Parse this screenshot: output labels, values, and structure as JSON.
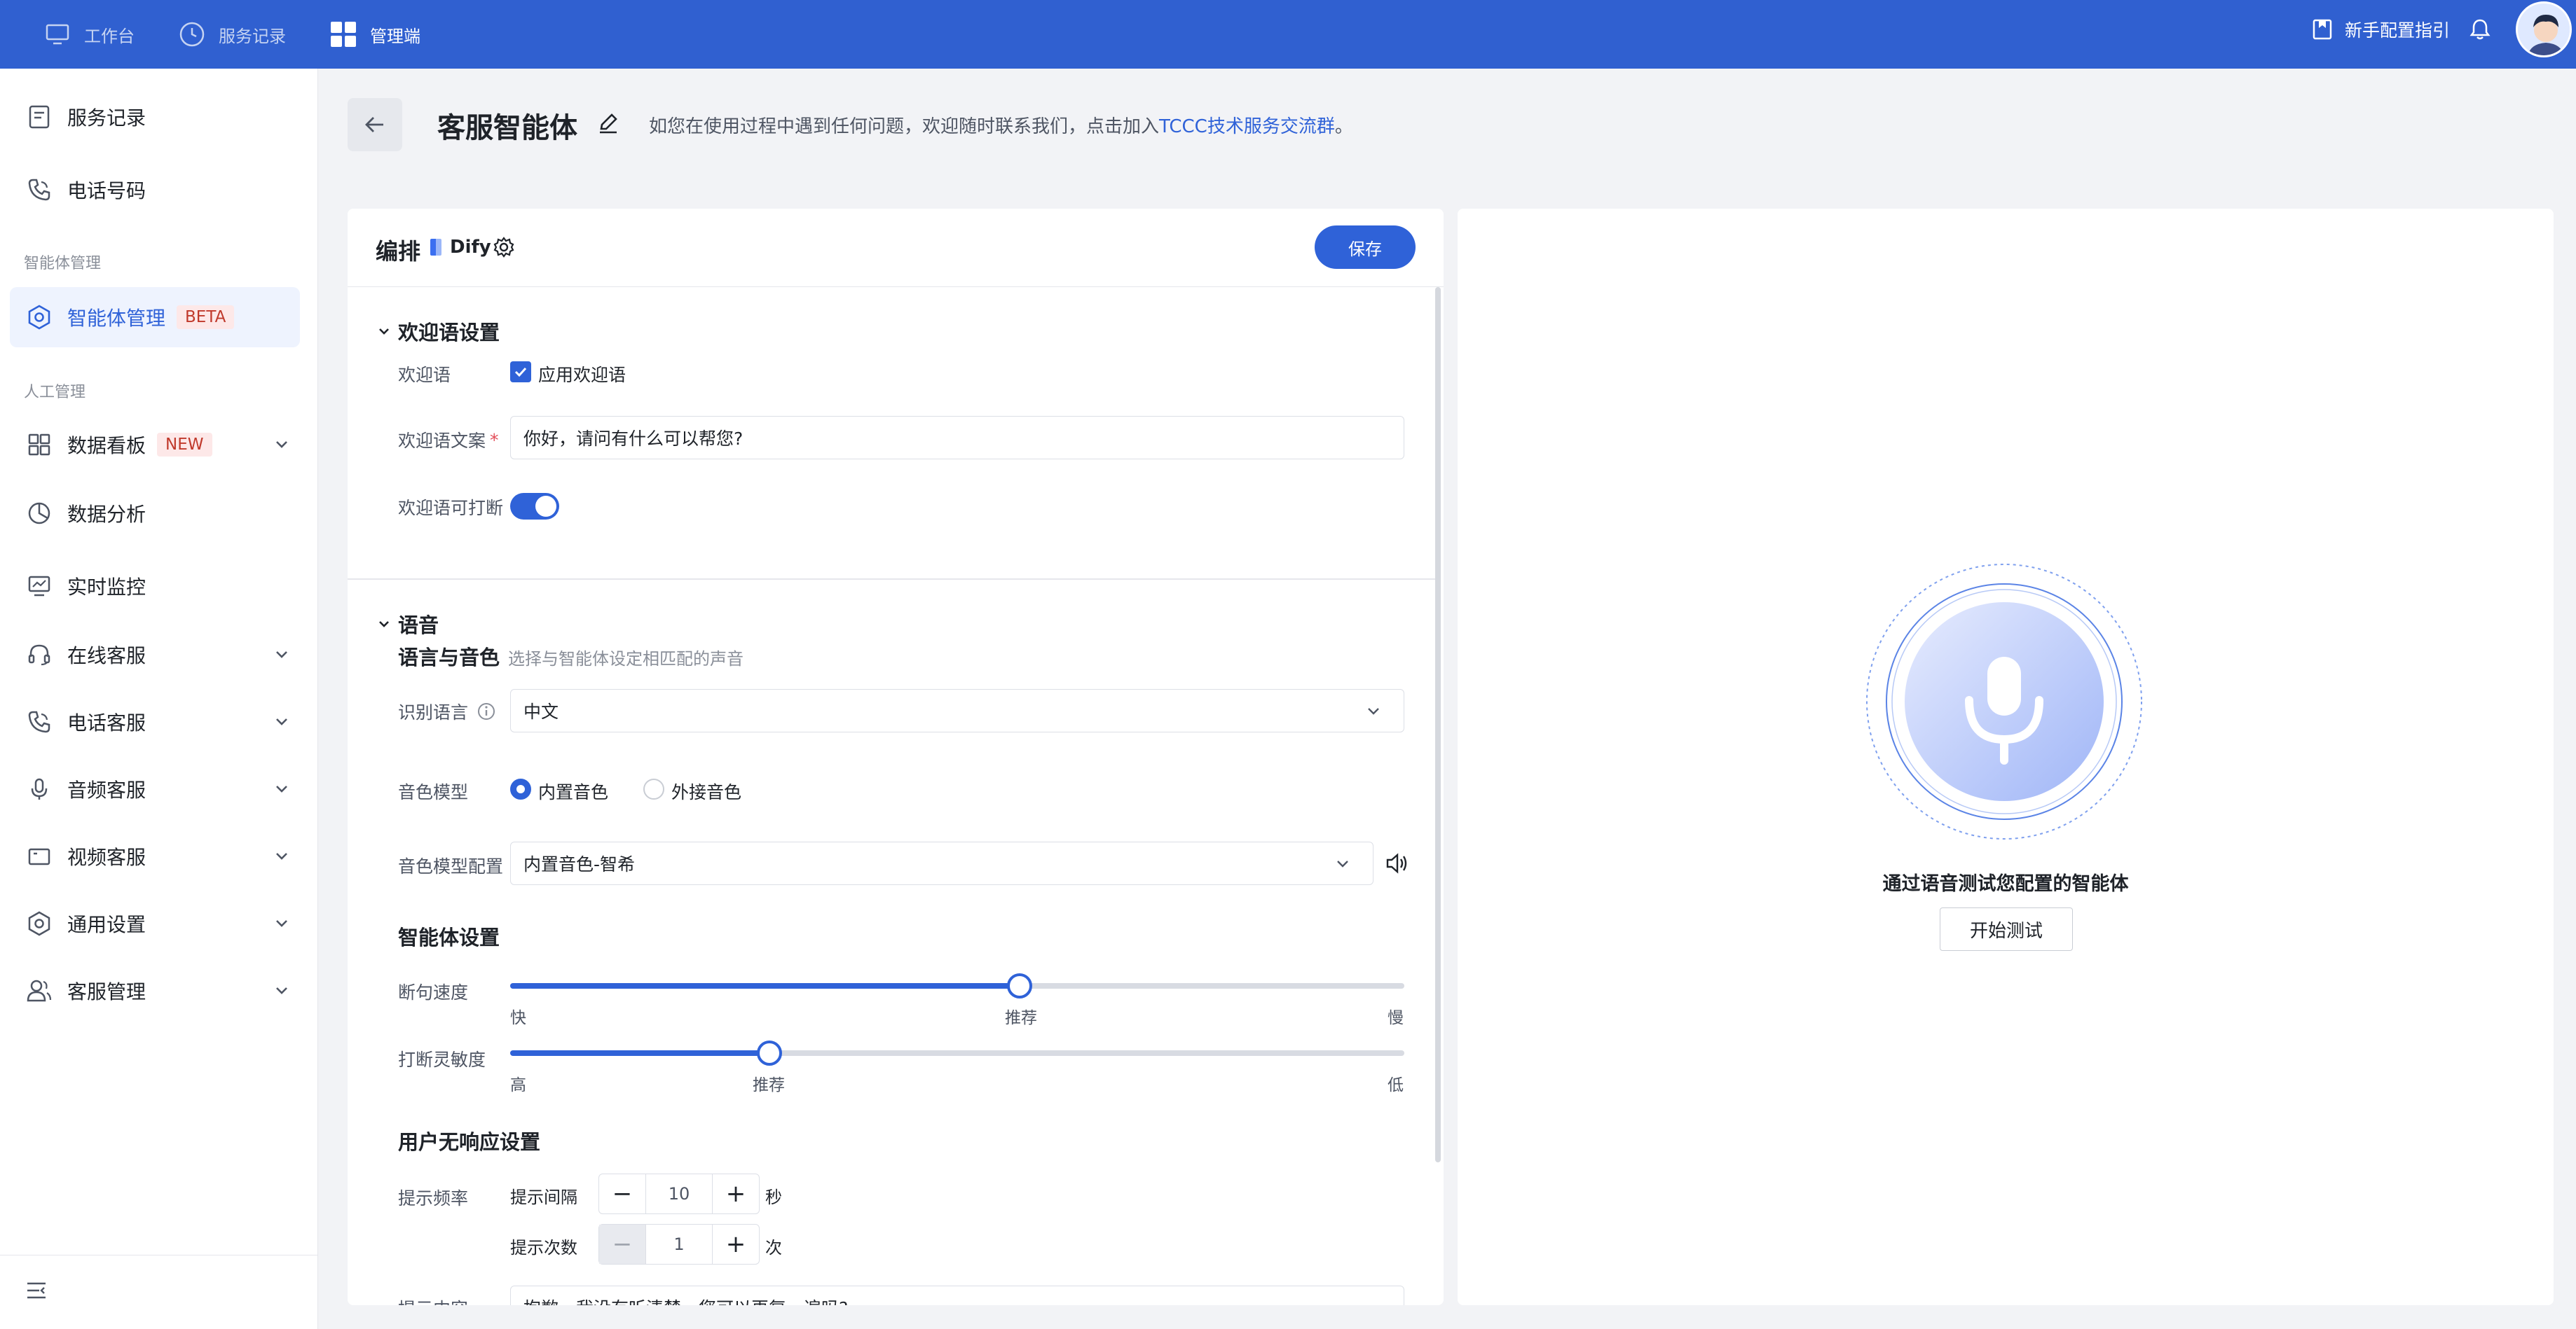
{
  "topbar": {
    "nav": [
      {
        "label": "工作台",
        "icon": "monitor-icon"
      },
      {
        "label": "服务记录",
        "icon": "clock-icon"
      },
      {
        "label": "管理端",
        "icon": "grid-icon"
      }
    ],
    "guide_label": "新手配置指引",
    "colors": {
      "bar": "#3060d0",
      "accent": "#2f62d8"
    }
  },
  "sidebar": {
    "items_top": [
      {
        "label": "服务记录",
        "icon": "document-icon"
      },
      {
        "label": "电话号码",
        "icon": "phone-icon"
      }
    ],
    "group_agent": "智能体管理",
    "agent_item": {
      "label": "智能体管理",
      "badge": "BETA",
      "icon": "hexagon-gear-icon"
    },
    "group_manual": "人工管理",
    "items_manual": [
      {
        "label": "数据看板",
        "badge": "NEW",
        "icon": "dashboard-icon"
      },
      {
        "label": "数据分析",
        "icon": "pie-icon"
      },
      {
        "label": "实时监控",
        "icon": "monitor-chart-icon"
      },
      {
        "label": "在线客服",
        "icon": "headset-icon"
      },
      {
        "label": "电话客服",
        "icon": "phone-icon"
      },
      {
        "label": "音频客服",
        "icon": "microphone-icon"
      },
      {
        "label": "视频客服",
        "icon": "video-icon"
      },
      {
        "label": "通用设置",
        "icon": "gear-icon"
      },
      {
        "label": "客服管理",
        "icon": "users-icon"
      }
    ]
  },
  "header": {
    "title": "客服智能体",
    "hint_prefix": "如您在使用过程中遇到任何问题，欢迎随时联系我们，点击加入",
    "hint_link": "TCCC技术服务交流群",
    "hint_suffix": "。"
  },
  "editor": {
    "title": "编排",
    "provider": "Dify",
    "save_label": "保存",
    "welcome": {
      "section_title": "欢迎语设置",
      "label_welcome": "欢迎语",
      "checkbox_label": "应用欢迎语",
      "checkbox_checked": true,
      "label_text": "欢迎语文案",
      "required_mark": "*",
      "text_value": "你好，请问有什么可以帮您?",
      "label_interrupt": "欢迎语可打断",
      "interrupt_on": true
    },
    "voice": {
      "section_title": "语音",
      "lang_title": "语言与音色",
      "lang_desc": "选择与智能体设定相匹配的声音",
      "label_lang": "识别语言",
      "lang_value": "中文",
      "label_model": "音色模型",
      "model_options": [
        "内置音色",
        "外接音色"
      ],
      "model_selected": 0,
      "label_model_config": "音色模型配置",
      "model_config_value": "内置音色-智希"
    },
    "agent": {
      "title": "智能体设置",
      "speed": {
        "label": "断句速度",
        "left": "快",
        "mid": "推荐",
        "right": "慢",
        "value": 0.57
      },
      "sensitivity": {
        "label": "打断灵敏度",
        "left": "高",
        "mid": "推荐",
        "right": "低",
        "value": 0.29
      }
    },
    "no_response": {
      "title": "用户无响应设置",
      "label_freq": "提示频率",
      "interval_label": "提示间隔",
      "interval_value": "10",
      "interval_unit": "秒",
      "count_label": "提示次数",
      "count_value": "1",
      "count_unit": "次",
      "label_content": "提示内容",
      "content_value": "抱歉，我没有听清楚，您可以再复一遍吗?"
    }
  },
  "test_panel": {
    "caption": "通过语音测试您配置的智能体",
    "button_label": "开始测试"
  }
}
